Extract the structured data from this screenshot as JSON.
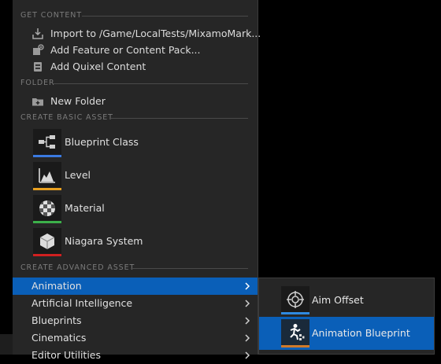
{
  "colors": {
    "blueprint_class": "#3a7ae0",
    "level": "#e8a020",
    "material": "#3cb04a",
    "niagara_system": "#d02020",
    "aim_offset": "#2f8ae0",
    "animation_blueprint": "#d07a2a",
    "highlight": "#0a5fb8"
  },
  "sections": {
    "get_content": "GET CONTENT",
    "folder": "FOLDER",
    "basic_asset": "CREATE BASIC ASSET",
    "advanced_asset": "CREATE ADVANCED ASSET"
  },
  "get_content": [
    {
      "label": "Import to /Game/LocalTests/MixamoMark...",
      "icon": "import-icon"
    },
    {
      "label": "Add Feature or Content Pack...",
      "icon": "feature-pack-icon"
    },
    {
      "label": "Add Quixel Content",
      "icon": "quixel-icon"
    }
  ],
  "folder": [
    {
      "label": "New Folder",
      "icon": "new-folder-icon"
    }
  ],
  "basic_assets": [
    {
      "label": "Blueprint Class",
      "icon": "blueprint-class-icon"
    },
    {
      "label": "Level",
      "icon": "level-icon"
    },
    {
      "label": "Material",
      "icon": "material-icon"
    },
    {
      "label": "Niagara System",
      "icon": "niagara-system-icon"
    }
  ],
  "advanced": [
    {
      "label": "Animation"
    },
    {
      "label": "Artificial Intelligence"
    },
    {
      "label": "Blueprints"
    },
    {
      "label": "Cinematics"
    },
    {
      "label": "Editor Utilities"
    }
  ],
  "animation_submenu": [
    {
      "label": "Aim Offset",
      "icon": "aim-offset-icon"
    },
    {
      "label": "Animation Blueprint",
      "icon": "animation-blueprint-icon"
    }
  ]
}
